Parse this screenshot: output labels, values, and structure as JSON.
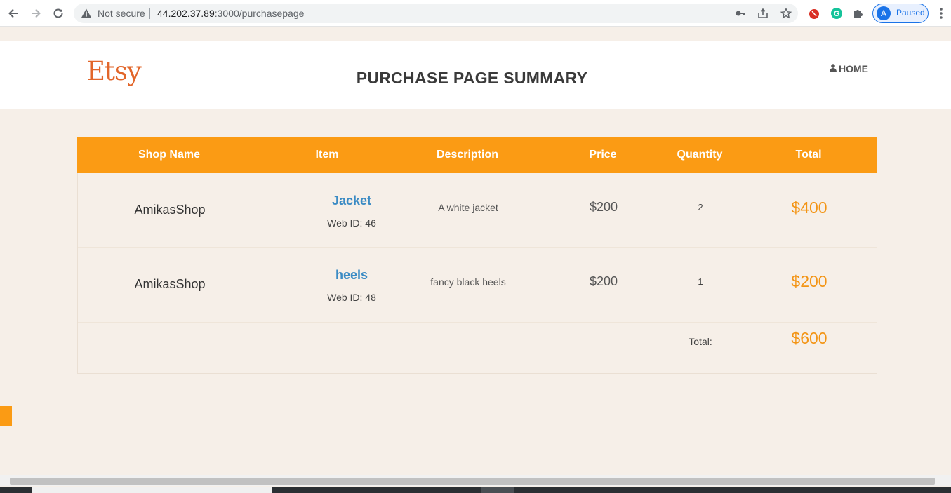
{
  "browser": {
    "not_secure_label": "Not secure",
    "url_host": "44.202.37.89",
    "url_rest": ":3000/purchasepage",
    "profile_initial": "A",
    "profile_status": "Paused"
  },
  "header": {
    "logo": "Etsy",
    "title": "PURCHASE PAGE SUMMARY",
    "home_label": "HOME"
  },
  "table": {
    "columns": [
      "Shop Name",
      "Item",
      "Description",
      "Price",
      "Quantity",
      "Total"
    ],
    "rows": [
      {
        "shop": "AmikasShop",
        "item": "Jacket",
        "web_id": "Web ID: 46",
        "description": "A white jacket",
        "price": "$200",
        "quantity": "2",
        "total": "$400"
      },
      {
        "shop": "AmikasShop",
        "item": "heels",
        "web_id": "Web ID: 48",
        "description": "fancy black heels",
        "price": "$200",
        "quantity": "1",
        "total": "$200"
      }
    ],
    "grand_total_label": "Total:",
    "grand_total": "$600"
  },
  "colors": {
    "accent": "#fb9b14",
    "logo": "#e2662a",
    "link": "#3b8bc4",
    "background": "#f6efe8"
  }
}
